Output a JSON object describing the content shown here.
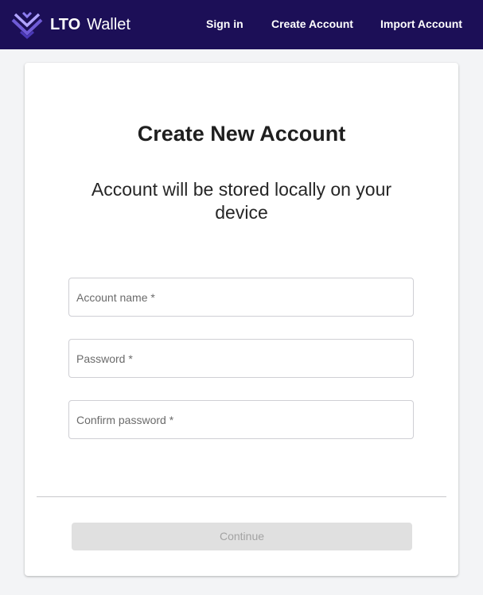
{
  "header": {
    "brand_strong": "LTO",
    "brand_light": "Wallet",
    "logo_icon": "lto-chevrons-logo",
    "background_color": "#1c0f57",
    "nav": {
      "sign_in": "Sign in",
      "create_account": "Create Account",
      "import_account": "Import Account"
    }
  },
  "form": {
    "title": "Create New Account",
    "subtitle": "Account will be stored locally on your device",
    "account_name_placeholder": "Account name *",
    "password_placeholder": "Password *",
    "confirm_password_placeholder": "Confirm password *",
    "continue_label": "Continue",
    "continue_disabled": true
  }
}
